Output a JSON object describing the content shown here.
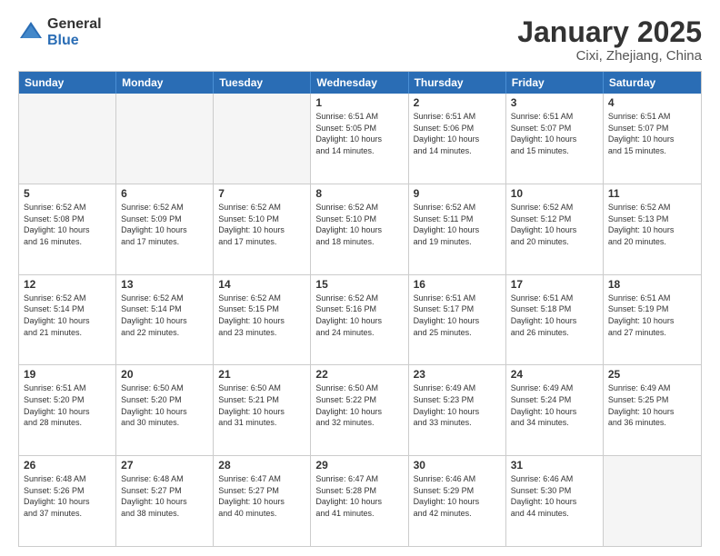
{
  "logo": {
    "general": "General",
    "blue": "Blue"
  },
  "title": "January 2025",
  "subtitle": "Cixi, Zhejiang, China",
  "header_days": [
    "Sunday",
    "Monday",
    "Tuesday",
    "Wednesday",
    "Thursday",
    "Friday",
    "Saturday"
  ],
  "weeks": [
    [
      {
        "date": "",
        "info": ""
      },
      {
        "date": "",
        "info": ""
      },
      {
        "date": "",
        "info": ""
      },
      {
        "date": "1",
        "info": "Sunrise: 6:51 AM\nSunset: 5:05 PM\nDaylight: 10 hours\nand 14 minutes."
      },
      {
        "date": "2",
        "info": "Sunrise: 6:51 AM\nSunset: 5:06 PM\nDaylight: 10 hours\nand 14 minutes."
      },
      {
        "date": "3",
        "info": "Sunrise: 6:51 AM\nSunset: 5:07 PM\nDaylight: 10 hours\nand 15 minutes."
      },
      {
        "date": "4",
        "info": "Sunrise: 6:51 AM\nSunset: 5:07 PM\nDaylight: 10 hours\nand 15 minutes."
      }
    ],
    [
      {
        "date": "5",
        "info": "Sunrise: 6:52 AM\nSunset: 5:08 PM\nDaylight: 10 hours\nand 16 minutes."
      },
      {
        "date": "6",
        "info": "Sunrise: 6:52 AM\nSunset: 5:09 PM\nDaylight: 10 hours\nand 17 minutes."
      },
      {
        "date": "7",
        "info": "Sunrise: 6:52 AM\nSunset: 5:10 PM\nDaylight: 10 hours\nand 17 minutes."
      },
      {
        "date": "8",
        "info": "Sunrise: 6:52 AM\nSunset: 5:10 PM\nDaylight: 10 hours\nand 18 minutes."
      },
      {
        "date": "9",
        "info": "Sunrise: 6:52 AM\nSunset: 5:11 PM\nDaylight: 10 hours\nand 19 minutes."
      },
      {
        "date": "10",
        "info": "Sunrise: 6:52 AM\nSunset: 5:12 PM\nDaylight: 10 hours\nand 20 minutes."
      },
      {
        "date": "11",
        "info": "Sunrise: 6:52 AM\nSunset: 5:13 PM\nDaylight: 10 hours\nand 20 minutes."
      }
    ],
    [
      {
        "date": "12",
        "info": "Sunrise: 6:52 AM\nSunset: 5:14 PM\nDaylight: 10 hours\nand 21 minutes."
      },
      {
        "date": "13",
        "info": "Sunrise: 6:52 AM\nSunset: 5:14 PM\nDaylight: 10 hours\nand 22 minutes."
      },
      {
        "date": "14",
        "info": "Sunrise: 6:52 AM\nSunset: 5:15 PM\nDaylight: 10 hours\nand 23 minutes."
      },
      {
        "date": "15",
        "info": "Sunrise: 6:52 AM\nSunset: 5:16 PM\nDaylight: 10 hours\nand 24 minutes."
      },
      {
        "date": "16",
        "info": "Sunrise: 6:51 AM\nSunset: 5:17 PM\nDaylight: 10 hours\nand 25 minutes."
      },
      {
        "date": "17",
        "info": "Sunrise: 6:51 AM\nSunset: 5:18 PM\nDaylight: 10 hours\nand 26 minutes."
      },
      {
        "date": "18",
        "info": "Sunrise: 6:51 AM\nSunset: 5:19 PM\nDaylight: 10 hours\nand 27 minutes."
      }
    ],
    [
      {
        "date": "19",
        "info": "Sunrise: 6:51 AM\nSunset: 5:20 PM\nDaylight: 10 hours\nand 28 minutes."
      },
      {
        "date": "20",
        "info": "Sunrise: 6:50 AM\nSunset: 5:20 PM\nDaylight: 10 hours\nand 30 minutes."
      },
      {
        "date": "21",
        "info": "Sunrise: 6:50 AM\nSunset: 5:21 PM\nDaylight: 10 hours\nand 31 minutes."
      },
      {
        "date": "22",
        "info": "Sunrise: 6:50 AM\nSunset: 5:22 PM\nDaylight: 10 hours\nand 32 minutes."
      },
      {
        "date": "23",
        "info": "Sunrise: 6:49 AM\nSunset: 5:23 PM\nDaylight: 10 hours\nand 33 minutes."
      },
      {
        "date": "24",
        "info": "Sunrise: 6:49 AM\nSunset: 5:24 PM\nDaylight: 10 hours\nand 34 minutes."
      },
      {
        "date": "25",
        "info": "Sunrise: 6:49 AM\nSunset: 5:25 PM\nDaylight: 10 hours\nand 36 minutes."
      }
    ],
    [
      {
        "date": "26",
        "info": "Sunrise: 6:48 AM\nSunset: 5:26 PM\nDaylight: 10 hours\nand 37 minutes."
      },
      {
        "date": "27",
        "info": "Sunrise: 6:48 AM\nSunset: 5:27 PM\nDaylight: 10 hours\nand 38 minutes."
      },
      {
        "date": "28",
        "info": "Sunrise: 6:47 AM\nSunset: 5:27 PM\nDaylight: 10 hours\nand 40 minutes."
      },
      {
        "date": "29",
        "info": "Sunrise: 6:47 AM\nSunset: 5:28 PM\nDaylight: 10 hours\nand 41 minutes."
      },
      {
        "date": "30",
        "info": "Sunrise: 6:46 AM\nSunset: 5:29 PM\nDaylight: 10 hours\nand 42 minutes."
      },
      {
        "date": "31",
        "info": "Sunrise: 6:46 AM\nSunset: 5:30 PM\nDaylight: 10 hours\nand 44 minutes."
      },
      {
        "date": "",
        "info": ""
      }
    ]
  ]
}
